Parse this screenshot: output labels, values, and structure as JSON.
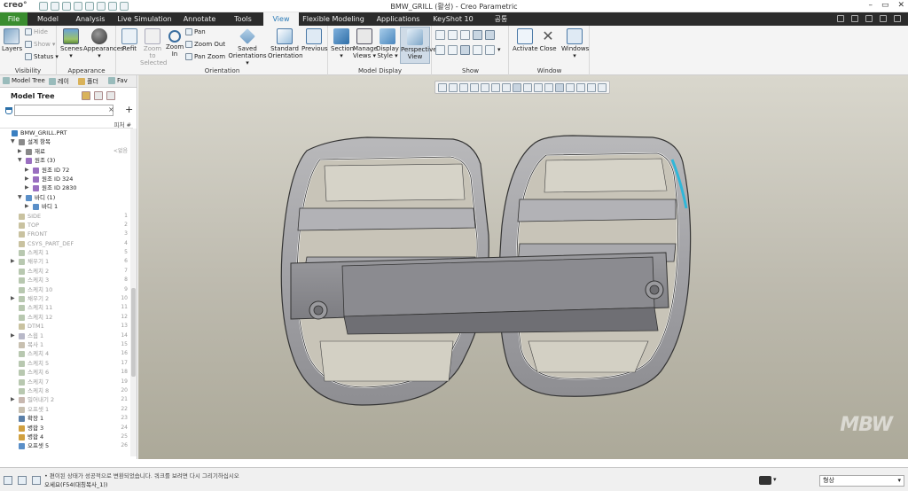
{
  "app": {
    "logo": "creo°",
    "window_title": "BMW_GRILL (활성) - Creo Parametric"
  },
  "tabs": [
    "File",
    "Model",
    "Analysis",
    "Live Simulation",
    "Annotate",
    "Tools",
    "View",
    "Flexible Modeling",
    "Applications",
    "KeyShot 10",
    "공통"
  ],
  "active_tab": "View",
  "ribbon": {
    "visibility": {
      "layers": "Layers",
      "hide": "Hide",
      "show": "Show",
      "status": "Status",
      "group": "Visibility"
    },
    "appearance": {
      "scenes": "Scenes",
      "appearances": "Appearances",
      "group": "Appearance"
    },
    "orientation": {
      "refit": "Refit",
      "zoom_sel_1": "Zoom to",
      "zoom_sel_2": "Selected",
      "zoom_in_1": "Zoom",
      "zoom_in_2": "In",
      "pan": "Pan",
      "zoom_out": "Zoom Out",
      "pan_zoom": "Pan Zoom",
      "saved_1": "Saved",
      "saved_2": "Orientations",
      "standard_1": "Standard",
      "standard_2": "Orientation",
      "previous": "Previous",
      "group": "Orientation"
    },
    "model_display": {
      "section": "Section",
      "manage_1": "Manage",
      "manage_2": "Views",
      "display_1": "Display",
      "display_2": "Style",
      "perspective_1": "Perspective",
      "perspective_2": "View",
      "group": "Model Display"
    },
    "show": {
      "group": "Show"
    },
    "window": {
      "activate": "Activate",
      "close": "Close",
      "windows": "Windows",
      "group": "Window"
    }
  },
  "left_panel": {
    "tabs": [
      "Model Tree",
      "레이",
      "폴더",
      "Fav"
    ],
    "header": "Model Tree",
    "filter_placeholder": "",
    "column": "피처 #"
  },
  "tree": [
    {
      "label": "BMW_GRILL.PRT",
      "num": "",
      "indent": 0,
      "exp": "",
      "icon": "#3a7fc1",
      "dim": false
    },
    {
      "label": "설계 항목",
      "num": "",
      "indent": 1,
      "exp": "▼",
      "icon": "#8a8a8a",
      "dim": false
    },
    {
      "label": "재료",
      "num": "<없음",
      "indent": 2,
      "exp": "▶",
      "icon": "#888",
      "dim": false
    },
    {
      "label": "원조 (3)",
      "num": "",
      "indent": 2,
      "exp": "▼",
      "icon": "#9a6fc0",
      "dim": false
    },
    {
      "label": "원조 ID 72",
      "num": "",
      "indent": 3,
      "exp": "▶",
      "icon": "#9a6fc0",
      "dim": false
    },
    {
      "label": "원조 ID 324",
      "num": "",
      "indent": 3,
      "exp": "▶",
      "icon": "#9a6fc0",
      "dim": false
    },
    {
      "label": "원조 ID 2830",
      "num": "",
      "indent": 3,
      "exp": "▶",
      "icon": "#9a6fc0",
      "dim": false
    },
    {
      "label": "바디 (1)",
      "num": "",
      "indent": 2,
      "exp": "▼",
      "icon": "#5a8fc8",
      "dim": false
    },
    {
      "label": "바디 1",
      "num": "",
      "indent": 3,
      "exp": "▶",
      "icon": "#5a8fc8",
      "dim": false
    },
    {
      "label": "SIDE",
      "num": "1",
      "indent": 1,
      "exp": "",
      "icon": "#c9c2a0",
      "dim": true
    },
    {
      "label": "TOP",
      "num": "2",
      "indent": 1,
      "exp": "",
      "icon": "#c9c2a0",
      "dim": true
    },
    {
      "label": "FRONT",
      "num": "3",
      "indent": 1,
      "exp": "",
      "icon": "#c9c2a0",
      "dim": true
    },
    {
      "label": "CSYS_PART_DEF",
      "num": "4",
      "indent": 1,
      "exp": "",
      "icon": "#c9c2a0",
      "dim": true
    },
    {
      "label": "스케치 1",
      "num": "5",
      "indent": 1,
      "exp": "",
      "icon": "#b8c8b0",
      "dim": true
    },
    {
      "label": "채우기 1",
      "num": "6",
      "indent": 1,
      "exp": "▶",
      "icon": "#b8c8b0",
      "dim": true
    },
    {
      "label": "스케치 2",
      "num": "7",
      "indent": 1,
      "exp": "",
      "icon": "#b8c8b0",
      "dim": true
    },
    {
      "label": "스케치 3",
      "num": "8",
      "indent": 1,
      "exp": "",
      "icon": "#b8c8b0",
      "dim": true
    },
    {
      "label": "스케치 10",
      "num": "9",
      "indent": 1,
      "exp": "",
      "icon": "#b8c8b0",
      "dim": true
    },
    {
      "label": "채우기 2",
      "num": "10",
      "indent": 1,
      "exp": "▶",
      "icon": "#b8c8b0",
      "dim": true
    },
    {
      "label": "스케치 11",
      "num": "11",
      "indent": 1,
      "exp": "",
      "icon": "#b8c8b0",
      "dim": true
    },
    {
      "label": "스케치 12",
      "num": "12",
      "indent": 1,
      "exp": "",
      "icon": "#b8c8b0",
      "dim": true
    },
    {
      "label": "DTM1",
      "num": "13",
      "indent": 1,
      "exp": "",
      "icon": "#c9c2a0",
      "dim": true
    },
    {
      "label": "스윕 1",
      "num": "14",
      "indent": 1,
      "exp": "▶",
      "icon": "#b8b8c8",
      "dim": true
    },
    {
      "label": "복사 1",
      "num": "15",
      "indent": 1,
      "exp": "",
      "icon": "#c8c0b0",
      "dim": true
    },
    {
      "label": "스케치 4",
      "num": "16",
      "indent": 1,
      "exp": "",
      "icon": "#b8c8b0",
      "dim": true
    },
    {
      "label": "스케치 5",
      "num": "17",
      "indent": 1,
      "exp": "",
      "icon": "#b8c8b0",
      "dim": true
    },
    {
      "label": "스케치 6",
      "num": "18",
      "indent": 1,
      "exp": "",
      "icon": "#b8c8b0",
      "dim": true
    },
    {
      "label": "스케치 7",
      "num": "19",
      "indent": 1,
      "exp": "",
      "icon": "#b8c8b0",
      "dim": true
    },
    {
      "label": "스케치 8",
      "num": "20",
      "indent": 1,
      "exp": "",
      "icon": "#b8c8b0",
      "dim": true
    },
    {
      "label": "밀어내기 2",
      "num": "21",
      "indent": 1,
      "exp": "▶",
      "icon": "#c8b8b0",
      "dim": true
    },
    {
      "label": "오프셋 1",
      "num": "22",
      "indent": 1,
      "exp": "",
      "icon": "#c8c0b0",
      "dim": true
    },
    {
      "label": "확장 1",
      "num": "23",
      "indent": 1,
      "exp": "",
      "icon": "#5a7fa8",
      "dim": false
    },
    {
      "label": "병합 3",
      "num": "24",
      "indent": 1,
      "exp": "",
      "icon": "#d0a040",
      "dim": false
    },
    {
      "label": "병합 4",
      "num": "25",
      "indent": 1,
      "exp": "",
      "icon": "#d0a040",
      "dim": false
    },
    {
      "label": "오프셋 5",
      "num": "26",
      "indent": 1,
      "exp": "",
      "icon": "#5a8fc8",
      "dim": false
    }
  ],
  "status": {
    "line1": "• 편이된 상태가 성공적으로 변환되었습니다. 쿼크를 보려면 다시 그리기하십시오",
    "line2": "오세요(F54(대칭복사_1))",
    "selection": "형상"
  },
  "watermark": "MBW",
  "colors": {
    "accent": "#3a8d2f",
    "tab_active_text": "#2b7bb8",
    "highlight_edge": "#2fb7d9"
  }
}
